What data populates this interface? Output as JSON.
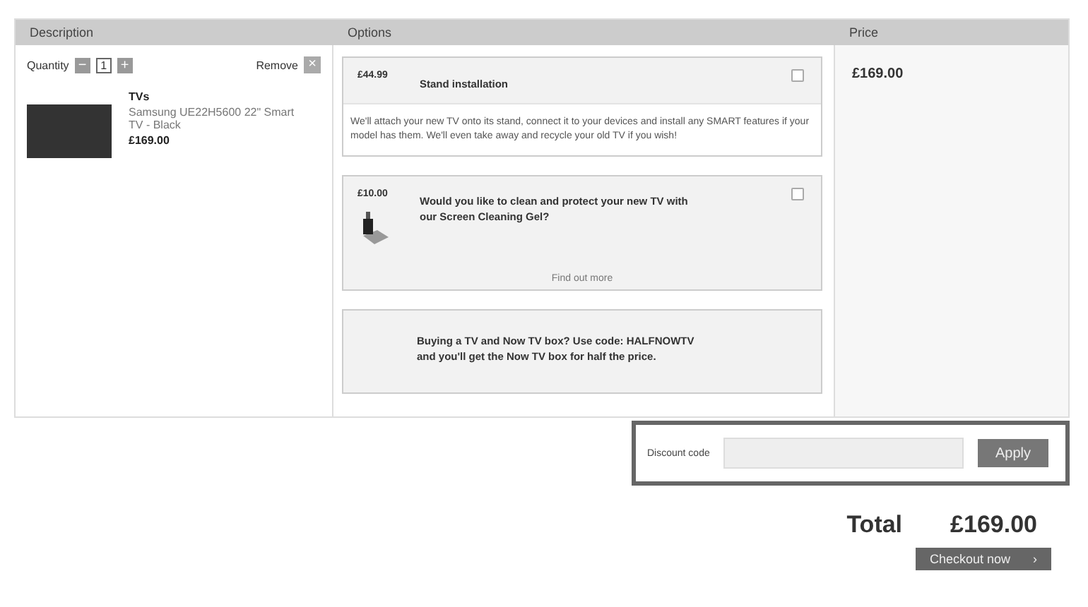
{
  "table": {
    "columns": [
      "Description",
      "Options",
      "Price"
    ],
    "item": {
      "quantity_label": "Quantity",
      "quantity": "1",
      "minus": "−",
      "plus": "+",
      "remove_label": "Remove",
      "remove_icon": "×",
      "category": "TVs",
      "name": "Samsung UE22H5600 22\" Smart TV - Black",
      "price": "£169.00"
    },
    "options": [
      {
        "kind": "service",
        "price": "£44.99",
        "title": "Stand installation",
        "checked": false,
        "description": "We'll attach your new TV onto its stand, connect it to your devices and install any SMART features if your model has them. We'll even take away and recycle your old TV if you wish!"
      },
      {
        "kind": "product",
        "price": "£10.00",
        "title": "Would you like to clean and protect your new TV with our Screen Cleaning Gel?",
        "checked": false,
        "link": "Find out more"
      },
      {
        "kind": "promo",
        "title": "Buying a TV and Now TV box? Use code: HALFNOWTV and you'll get the Now TV box for half the price."
      }
    ],
    "price": "£169.00"
  },
  "discount": {
    "label": "Discount code",
    "button": "Apply"
  },
  "total": {
    "label": "Total",
    "value": "£169.00"
  },
  "checkout": {
    "label": "Checkout now",
    "icon": "›"
  }
}
